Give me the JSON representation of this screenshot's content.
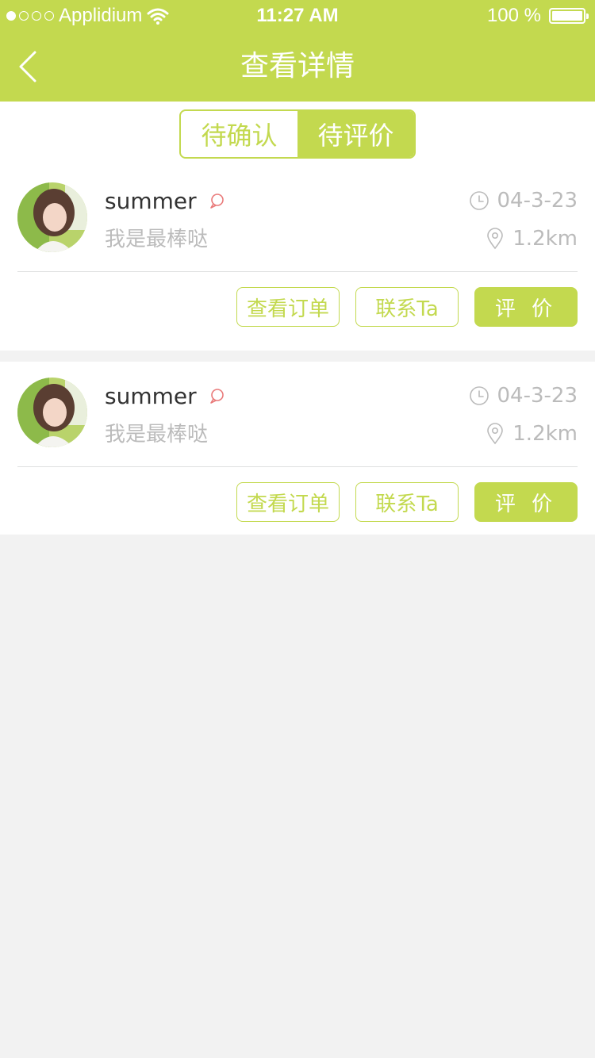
{
  "status_bar": {
    "carrier": "Applidium",
    "time": "11:27 AM",
    "battery": "100 %",
    "battery_level": 1.0,
    "signal_dots": [
      true,
      false,
      false,
      false
    ]
  },
  "nav": {
    "title": "查看详情",
    "back_icon": "chevron-left-icon"
  },
  "tabs": [
    {
      "label": "待确认",
      "active": false
    },
    {
      "label": "待评价",
      "active": true
    }
  ],
  "orders": [
    {
      "name": "summer",
      "message": "我是最棒哒",
      "date": "04-3-23",
      "distance": "1.2km",
      "buttons": {
        "view_order": "查看订单",
        "contact": "联系Ta",
        "rate": "评 价"
      }
    },
    {
      "name": "summer",
      "message": "我是最棒哒",
      "date": "04-3-23",
      "distance": "1.2km",
      "buttons": {
        "view_order": "查看订单",
        "contact": "联系Ta",
        "rate": "评 价"
      }
    }
  ],
  "colors": {
    "accent": "#C3D94F",
    "title": "#333333",
    "muted": "#BBBBBB",
    "divider": "#DEDFE0",
    "background": "#F2F2F2"
  }
}
